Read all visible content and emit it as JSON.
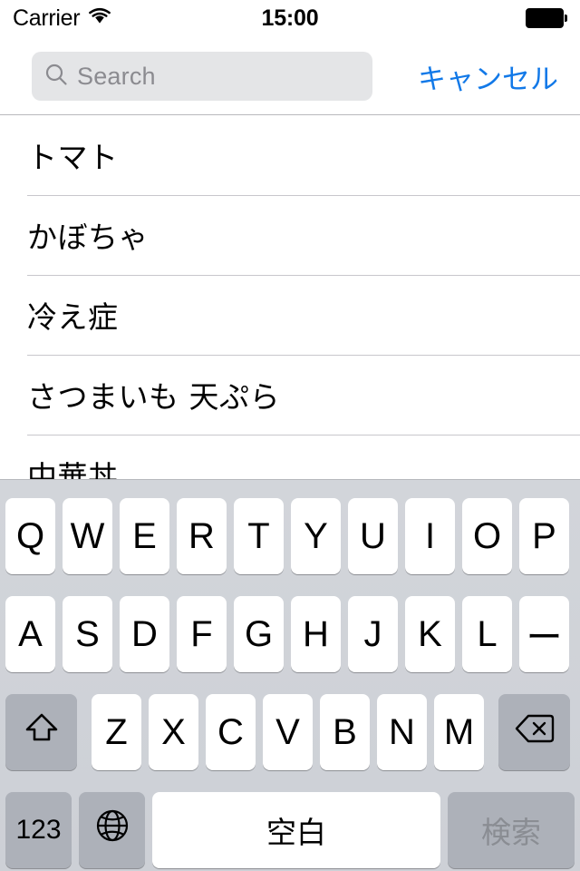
{
  "status_bar": {
    "carrier": "Carrier",
    "wifi_icon": "wifi-icon",
    "time": "15:00",
    "battery_icon": "battery-full-icon"
  },
  "search": {
    "placeholder": "Search",
    "value": "",
    "icon": "search-icon",
    "cancel_label": "キャンセル",
    "cancel_color": "#1279e8"
  },
  "results": {
    "items": [
      {
        "label": "トマト"
      },
      {
        "label": "かぼちゃ"
      },
      {
        "label": "冷え症"
      },
      {
        "label": "さつまいも 天ぷら"
      },
      {
        "label": "中華丼"
      }
    ]
  },
  "keyboard": {
    "row1": [
      "Q",
      "W",
      "E",
      "R",
      "T",
      "Y",
      "U",
      "I",
      "O",
      "P"
    ],
    "row2": [
      "A",
      "S",
      "D",
      "F",
      "G",
      "H",
      "J",
      "K",
      "L",
      "ー"
    ],
    "row3": [
      "Z",
      "X",
      "C",
      "V",
      "B",
      "N",
      "M"
    ],
    "shift_icon": "shift-icon",
    "delete_icon": "delete-icon",
    "numeric_label": "123",
    "globe_icon": "globe-icon",
    "space_label": "空白",
    "return_label": "検索"
  }
}
